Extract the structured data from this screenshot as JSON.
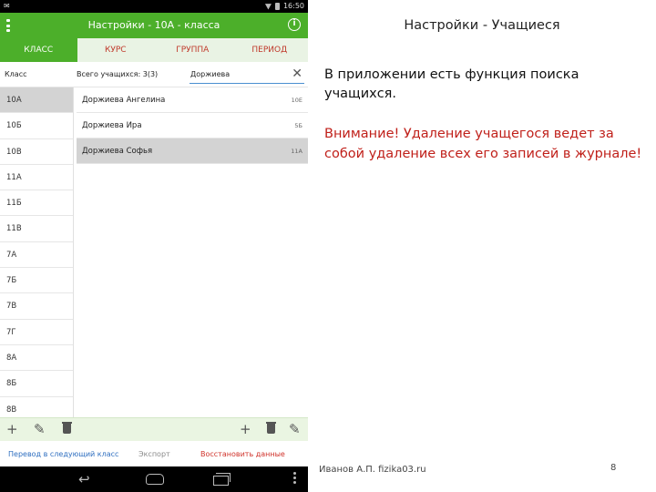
{
  "status_bar": {
    "time": "16:50"
  },
  "app_bar": {
    "title": "Настройки - 10А - класса",
    "info_icon": "i"
  },
  "tabs": [
    {
      "label": "КЛАСС",
      "active": true
    },
    {
      "label": "КУРС",
      "active": false
    },
    {
      "label": "ГРУППА",
      "active": false
    },
    {
      "label": "ПЕРИОД",
      "active": false
    }
  ],
  "list_header": {
    "class_label": "Класс",
    "total_label": "Всего учащихся: 3(3)",
    "search_value": "Доржиева"
  },
  "classes": [
    {
      "label": "10А",
      "selected": true
    },
    {
      "label": "10Б"
    },
    {
      "label": "10В"
    },
    {
      "label": "11А"
    },
    {
      "label": "11Б"
    },
    {
      "label": "11В"
    },
    {
      "label": "7А"
    },
    {
      "label": "7Б"
    },
    {
      "label": "7В"
    },
    {
      "label": "7Г"
    },
    {
      "label": "8А"
    },
    {
      "label": "8Б"
    },
    {
      "label": "8В"
    }
  ],
  "students": [
    {
      "name": "Доржиева Ангелина",
      "class": "10Е"
    },
    {
      "name": "Доржиева Ира",
      "class": "5Б"
    },
    {
      "name": "Доржиева Софья",
      "class": "11А",
      "selected": true
    }
  ],
  "bottom_actions": {
    "transfer": "Перевод в следующий класс",
    "export": "Экспорт",
    "restore": "Восстановить данные"
  },
  "slide": {
    "title": "Настройки - Учащиеся",
    "body": "В приложении есть функция поиска учащихся.",
    "warning": "Внимание! Удаление учащегося ведет за собой удаление всех его записей в журнале!",
    "author": "Иванов А.П. fizika03.ru",
    "page_number": "8"
  },
  "colors": {
    "accent_green": "#4caf2a",
    "tab_text": "#c0392b",
    "warning_red": "#c0201a",
    "link_blue": "#2f6fc0"
  },
  "icons": {
    "menu": "overflow-menu-icon",
    "info": "info-icon",
    "clear": "close-icon",
    "add": "plus-icon",
    "edit": "pencil-icon",
    "delete": "trash-icon",
    "nav_back": "back-icon",
    "nav_home": "home-icon",
    "nav_recent": "recent-apps-icon"
  }
}
